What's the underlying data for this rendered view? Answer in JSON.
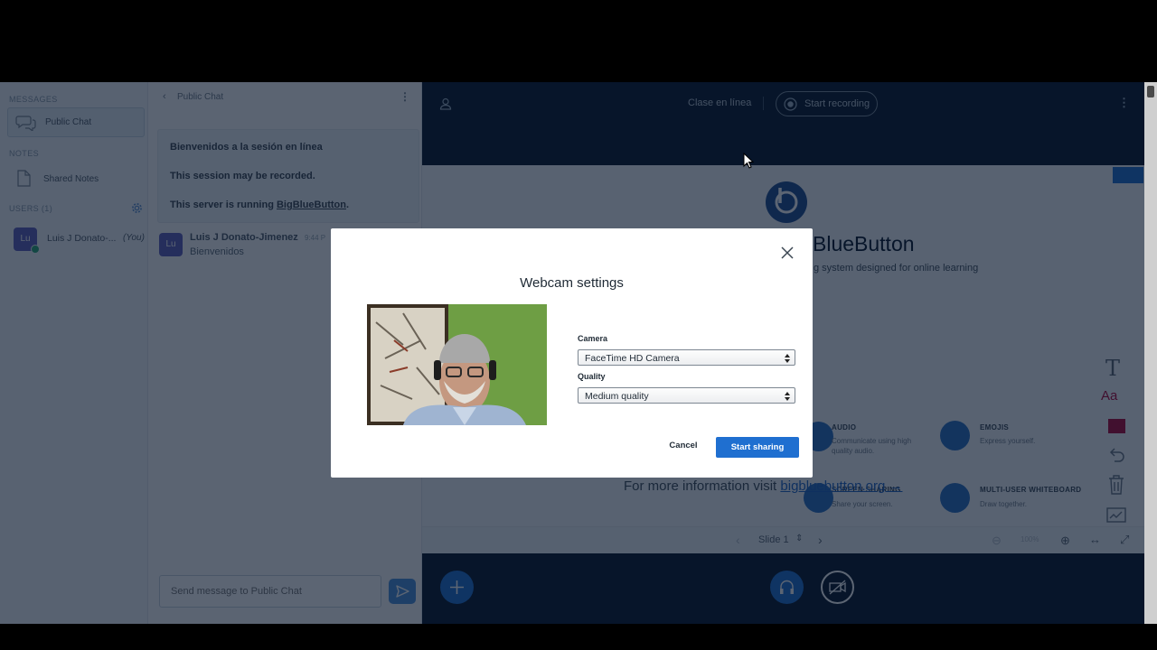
{
  "userlist": {
    "messages_title": "MESSAGES",
    "public_chat": "Public Chat",
    "notes_title": "NOTES",
    "shared_notes": "Shared Notes",
    "users_title": "USERS (1)",
    "user": {
      "initials": "Lu",
      "name": "Luis J Donato-...",
      "you": "(You)"
    }
  },
  "chat": {
    "header_title": "Public Chat",
    "welcome": [
      "Bienvenidos a la sesión en línea",
      "This session may be recorded.",
      "This server is running "
    ],
    "welcome_link": "BigBlueButton",
    "welcome_link_suffix": ".",
    "message": {
      "initials": "Lu",
      "sender": "Luis J Donato-Jimenez",
      "time": "9:44 P",
      "text": "Bienvenidos"
    },
    "input_placeholder": "Send message to Public Chat"
  },
  "navbar": {
    "meeting_name": "Clase en línea",
    "record_label": "Start recording"
  },
  "presentation": {
    "title": "BlueButton",
    "subtitle": "g system designed for online learning",
    "features": [
      {
        "title": "AUDIO",
        "desc1": "Communicate using high",
        "desc2": "quality audio."
      },
      {
        "title": "EMOJIS",
        "desc1": "Express yourself.",
        "desc2": ""
      },
      {
        "title": "SCREEN SHARING",
        "desc1": "Share your screen.",
        "desc2": ""
      },
      {
        "title": "MULTI-USER WHITEBOARD",
        "desc1": "Draw together.",
        "desc2": ""
      }
    ],
    "more_info_prefix": "For more information visit ",
    "more_info_link": "bigbluebutton.org →",
    "slide_label": "Slide 1",
    "zoom": "100%"
  },
  "modal": {
    "title": "Webcam settings",
    "camera_label": "Camera",
    "camera_value": "FaceTime HD Camera",
    "quality_label": "Quality",
    "quality_value": "Medium quality",
    "cancel_label": "Cancel",
    "start_label": "Start sharing"
  },
  "colors": {
    "accent": "#1f6fd0",
    "navbar_bg": "#06172a",
    "brand_blue": "#2a6fc2",
    "pen_color": "#b0063a"
  },
  "icons": [
    "user-icon",
    "record-icon",
    "kebab-icon",
    "chat-icon",
    "notes-icon",
    "gear-icon",
    "send-icon",
    "close-icon",
    "bbb-logo",
    "text-tool-icon",
    "font-icon",
    "color-swatch-icon",
    "undo-icon",
    "trash-icon",
    "multi-whiteboard-icon",
    "plus-icon",
    "headset-icon",
    "camera-off-icon",
    "zoom-in-icon",
    "zoom-out-icon",
    "fit-width-icon",
    "fullscreen-icon"
  ]
}
